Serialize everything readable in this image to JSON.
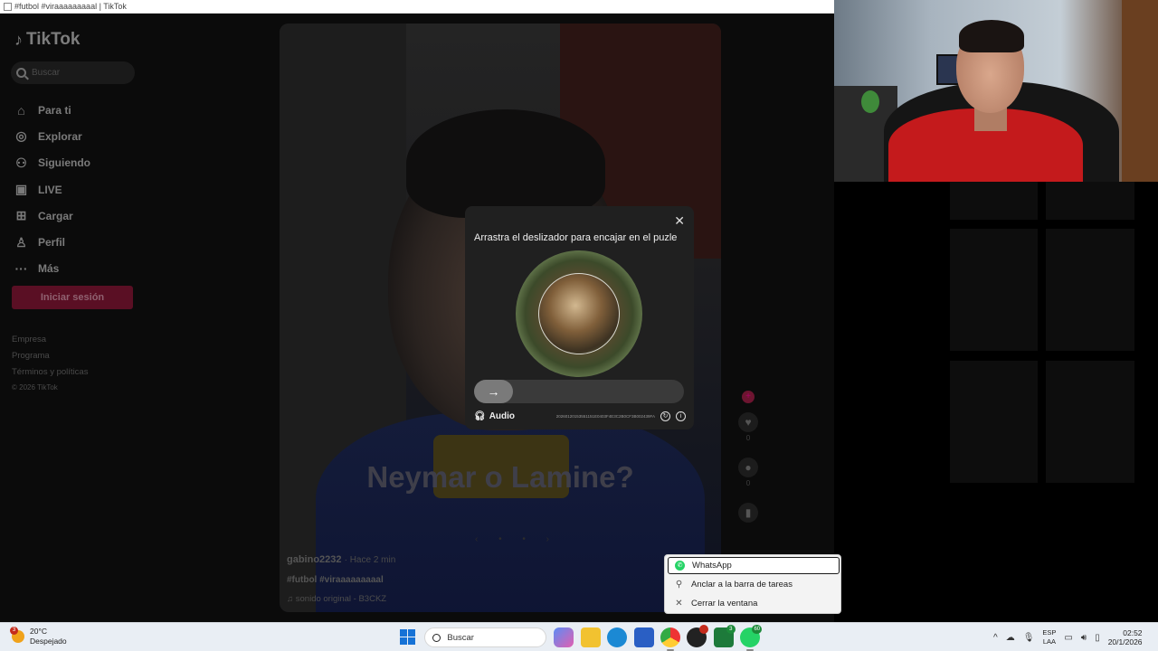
{
  "window": {
    "title": "#futbol #viraaaaaaaaal | TikTok"
  },
  "tiktok": {
    "logo": "TikTok",
    "search_placeholder": "Buscar",
    "nav": [
      {
        "label": "Para ti",
        "icon": "home-icon"
      },
      {
        "label": "Explorar",
        "icon": "compass-icon"
      },
      {
        "label": "Siguiendo",
        "icon": "following-icon"
      },
      {
        "label": "LIVE",
        "icon": "live-icon"
      },
      {
        "label": "Cargar",
        "icon": "upload-icon"
      },
      {
        "label": "Perfil",
        "icon": "profile-icon"
      },
      {
        "label": "Más",
        "icon": "more-icon"
      }
    ],
    "login_label": "Iniciar sesión",
    "footer": [
      "Empresa",
      "Programa",
      "Términos y políticas",
      "© 2026 TikTok"
    ],
    "video": {
      "overlay_text": "Neymar o Lamine?",
      "author": "gabino2232",
      "time": "· Hace 2 min",
      "tags": "#futbol #viraaaaaaaaal",
      "sound": "♫  sonido original - B3CKZ",
      "likes": "0",
      "comments": "0"
    }
  },
  "captcha": {
    "title": "Arrastra el deslizador para encajar en el puzle",
    "audio_label": "Audio",
    "code": "20260120153551151E0403F4E3C2B0CF3B002439FA"
  },
  "jumplist": {
    "items": [
      {
        "label": "WhatsApp",
        "icon": "whatsapp-icon"
      },
      {
        "label": "Anclar a la barra de tareas",
        "icon": "pin-icon"
      },
      {
        "label": "Cerrar la ventana",
        "icon": "close-icon"
      }
    ]
  },
  "taskbar": {
    "weather_temp": "20°C",
    "weather_desc": "Despejado",
    "weather_badge": "3",
    "search_placeholder": "Buscar",
    "lang_top": "ESP",
    "lang_bottom": "LAA",
    "time": "02:52",
    "date": "20/1/2026",
    "whatsapp_badge": "60",
    "xbox_badge": "3"
  }
}
